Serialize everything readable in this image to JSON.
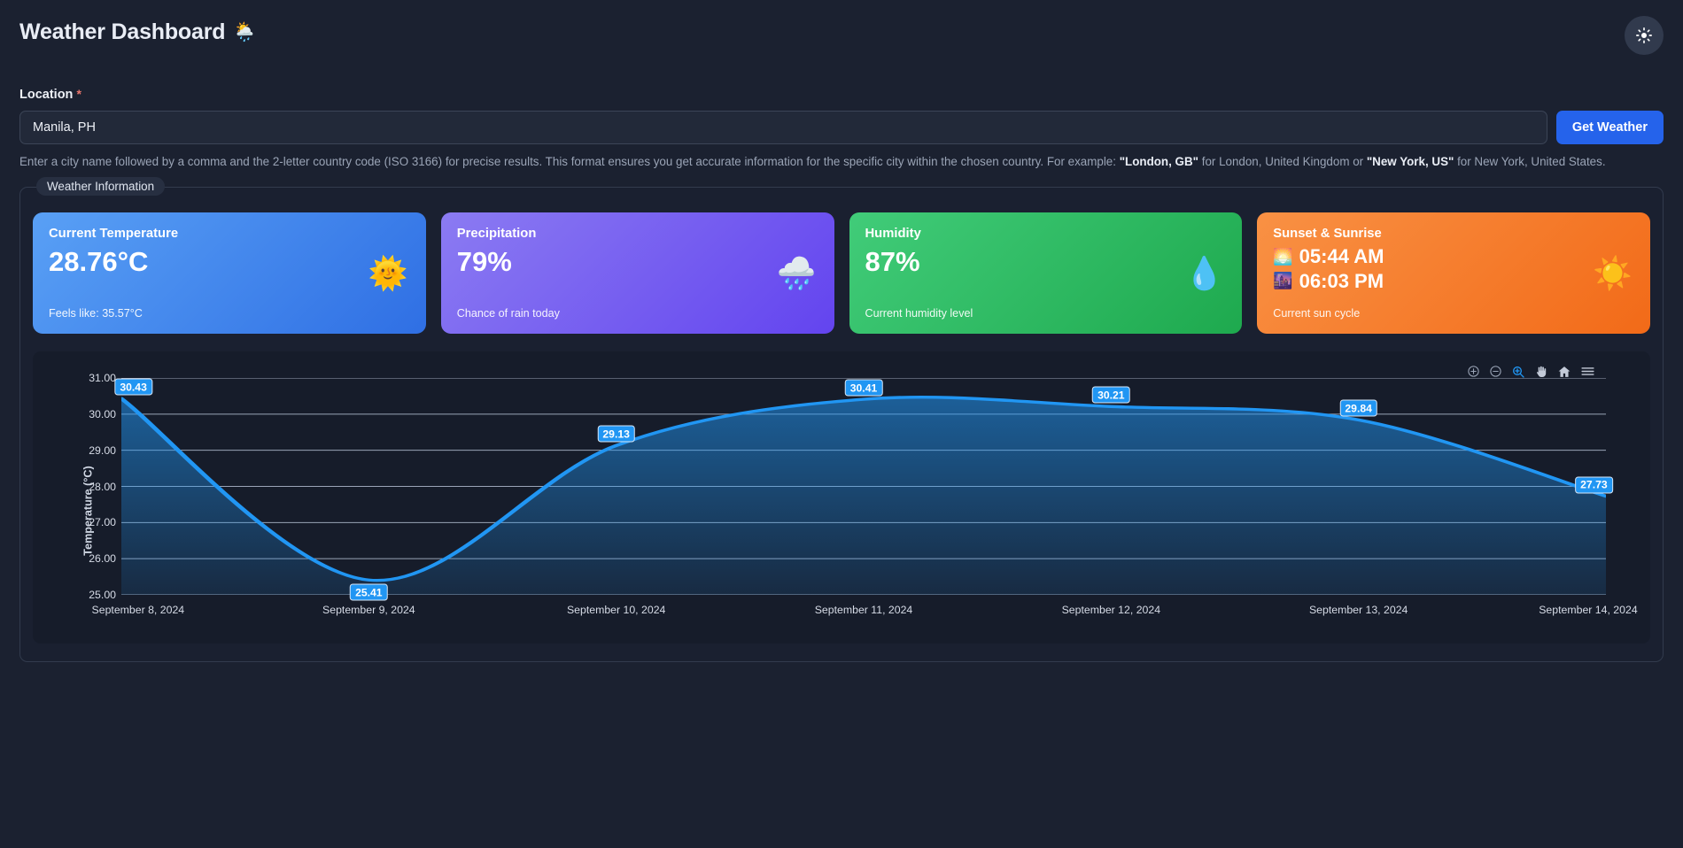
{
  "header": {
    "title": "Weather Dashboard",
    "title_emoji": "🌦️",
    "theme_toggle_icon": "sun-brightness-icon"
  },
  "form": {
    "label": "Location",
    "required_marker": "*",
    "input_value": "Manila, PH",
    "input_placeholder": "Manila, PH",
    "submit_label": "Get Weather",
    "helper_prefix": "Enter a city name followed by a comma and the 2-letter country code (ISO 3166) for precise results. This format ensures you get accurate information for the specific city within the chosen country. For example: ",
    "helper_example_1": "\"London, GB\"",
    "helper_mid_1": " for London, United Kingdom or ",
    "helper_example_2": "\"New York, US\"",
    "helper_suffix": " for New York, United States."
  },
  "fieldset": {
    "legend": "Weather Information"
  },
  "cards": [
    {
      "title": "Current Temperature",
      "value": "28.76°C",
      "sub": "Feels like: 35.57°C",
      "emoji": "🌞",
      "emoji_name": "sun-with-face-icon",
      "color": "#2f6fe4"
    },
    {
      "title": "Precipitation",
      "value": "79%",
      "sub": "Chance of rain today",
      "emoji": "🌧️",
      "emoji_name": "rain-cloud-icon",
      "color": "#6344ef"
    },
    {
      "title": "Humidity",
      "value": "87%",
      "sub": "Current humidity level",
      "emoji": "💧",
      "emoji_name": "water-droplet-icon",
      "color": "#1ea94e"
    }
  ],
  "sun_card": {
    "title": "Sunset & Sunrise",
    "sunrise_emoji": "🌅",
    "sunrise_emoji_name": "sunrise-icon",
    "sunrise_time": "05:44 AM",
    "sunset_emoji": "🌆",
    "sunset_emoji_name": "sunset-city-icon",
    "sunset_time": "06:03 PM",
    "sub": "Current sun cycle",
    "emoji": "☀️",
    "emoji_name": "sun-icon",
    "color": "#f26a18"
  },
  "chart_toolbar": {
    "zoom_in": "zoom-in-icon",
    "zoom_out": "zoom-out-icon",
    "selection_zoom": "selection-zoom-icon",
    "pan": "pan-hand-icon",
    "reset": "home-reset-icon",
    "menu": "hamburger-menu-icon",
    "active_tool": "selection-zoom-icon",
    "active_color": "#2196f3"
  },
  "chart_data": {
    "type": "line",
    "title": "",
    "xlabel": "",
    "ylabel": "Temperature (°C)",
    "ylim": [
      25.0,
      31.0
    ],
    "yticks": [
      "25.00",
      "26.00",
      "27.00",
      "28.00",
      "29.00",
      "30.00",
      "31.00"
    ],
    "ytick_values": [
      25.0,
      26.0,
      27.0,
      28.0,
      29.0,
      30.0,
      31.0
    ],
    "grid": true,
    "legend": "none",
    "fill": "area-gradient",
    "line_color": "#2196f3",
    "categories": [
      "September 8, 2024",
      "September 9, 2024",
      "September 10, 2024",
      "September 11, 2024",
      "September 12, 2024",
      "September 13, 2024",
      "September 14, 2024"
    ],
    "values": [
      30.43,
      25.41,
      29.13,
      30.41,
      30.21,
      29.84,
      27.73
    ],
    "data_labels": [
      "30.43",
      "25.41",
      "29.13",
      "30.41",
      "30.21",
      "29.84",
      "27.73"
    ],
    "series": [
      {
        "name": "Temperature",
        "values": [
          30.43,
          25.41,
          29.13,
          30.41,
          30.21,
          29.84,
          27.73
        ]
      }
    ]
  }
}
